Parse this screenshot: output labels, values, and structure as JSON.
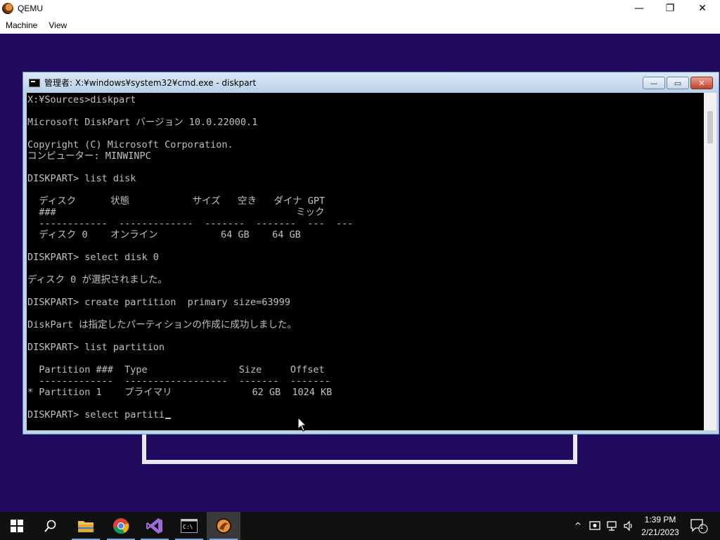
{
  "host": {
    "title": "QEMU",
    "controls": {
      "minimize": "—",
      "restore": "❐",
      "close": "✕"
    },
    "menu": [
      "Machine",
      "View"
    ]
  },
  "cmd": {
    "title": "管理者: X:¥windows¥system32¥cmd.exe - diskpart",
    "buttons": {
      "minimize": "—",
      "maximize": "▭",
      "close": "✕"
    },
    "lines": [
      "X:¥Sources>diskpart",
      "",
      "Microsoft DiskPart バージョン 10.0.22000.1",
      "",
      "Copyright (C) Microsoft Corporation.",
      "コンピューター: MINWINPC",
      "",
      "DISKPART> list disk",
      "",
      "  ディスク      状態           サイズ   空き   ダイナ GPT",
      "  ###                                          ミック",
      "  ------------  -------------  -------  -------  ---  ---",
      "  ディスク 0    オンライン           64 GB    64 GB",
      "",
      "DISKPART> select disk 0",
      "",
      "ディスク 0 が選択されました。",
      "",
      "DISKPART> create partition  primary size=63999",
      "",
      "DiskPart は指定したパーティションの作成に成功しました。",
      "",
      "DISKPART> list partition",
      "",
      "  Partition ###  Type                Size     Offset",
      "  -------------  ------------------  -------  -------",
      "* Partition 1    プライマリ              62 GB  1024 KB",
      "",
      "DISKPART> select partiti"
    ]
  },
  "taskbar": {
    "items": [
      "start-icon",
      "search-icon",
      "file-explorer-icon",
      "chrome-icon",
      "visual-studio-icon",
      "terminal-icon",
      "qemu-icon"
    ],
    "tray": {
      "chevron": "^",
      "notification_count": "1"
    },
    "clock": {
      "time": "1:39 PM",
      "date": "2/21/2023"
    }
  },
  "colors": {
    "desktop": "#1f0a5e",
    "console_bg": "#000000",
    "console_fg": "#c0c0c0"
  }
}
